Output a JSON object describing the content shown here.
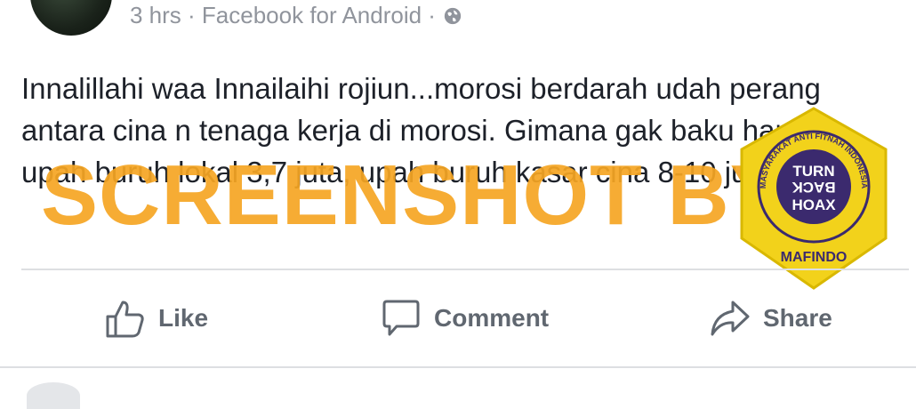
{
  "post": {
    "meta": "3 hrs · Facebook for Android ·",
    "text": "Innalillahi waa Innailaihi rojiun...morosi berdarah udah perang antara cina n tenaga kerja di morosi. Gimana gak baku hantam upah buruh lokal 3,7 juta, upah buruh kasar cina 8-10 juta."
  },
  "watermark": {
    "text": "SCREENSHOT BY",
    "color": "#f6a623"
  },
  "badge": {
    "ring_text": "MASYARAKAT ANTI FITNAH INDONESIA",
    "center_line1": "TURN",
    "center_line2": "BACK",
    "center_line3": "HOAX",
    "bottom": "MAFINDO",
    "colors": {
      "outer": "#f2d21b",
      "inner": "#3b2a6e"
    }
  },
  "actions": {
    "like": "Like",
    "comment": "Comment",
    "share": "Share"
  }
}
